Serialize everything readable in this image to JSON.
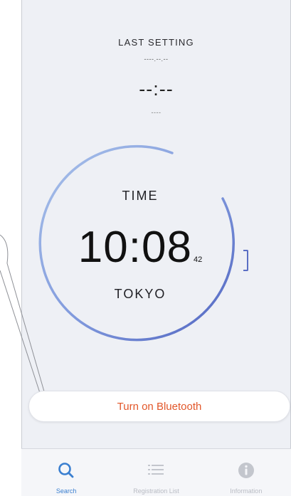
{
  "last_setting": {
    "title": "LAST SETTING",
    "date": "----.--.--",
    "time": "--:--",
    "city": "----"
  },
  "dial": {
    "label": "TIME",
    "time": "10:08",
    "seconds": "42",
    "city": "TOKYO"
  },
  "bluetooth_button": {
    "label": "Turn on Bluetooth"
  },
  "tabbar": {
    "tabs": [
      {
        "label": "Search",
        "icon": "search-icon",
        "active": true
      },
      {
        "label": "Registration List",
        "icon": "list-icon",
        "active": false
      },
      {
        "label": "Information",
        "icon": "info-icon",
        "active": false
      }
    ]
  },
  "colors": {
    "accent_blue": "#3a7fd0",
    "button_text_orange": "#e2572a",
    "dial_ring": "#5b6fc4",
    "background": "#eef0f5"
  }
}
